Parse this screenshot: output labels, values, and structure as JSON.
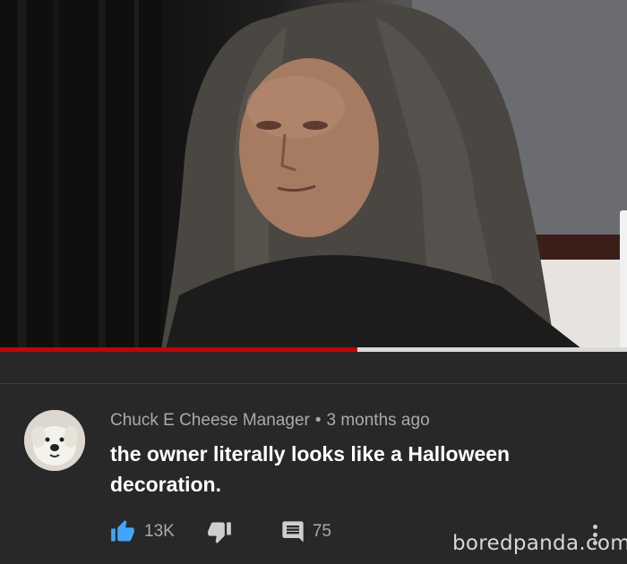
{
  "video": {
    "progress_fraction": 0.57
  },
  "comment": {
    "author": "Chuck E Cheese Manager",
    "separator": "•",
    "time": "3 months ago",
    "text": "the owner literally looks like a Halloween decoration.",
    "likes": "13K",
    "replies": "75"
  },
  "icons": {
    "like": "thumbs-up-icon",
    "dislike": "thumbs-down-icon",
    "reply": "comment-icon",
    "more": "more-vert-icon"
  },
  "colors": {
    "background": "#282828",
    "progress_played": "#cc0000",
    "like_active": "#3ea6ff",
    "meta_text": "#aaaaaa",
    "comment_text": "#ffffff"
  },
  "watermark": "boredpanda.com"
}
